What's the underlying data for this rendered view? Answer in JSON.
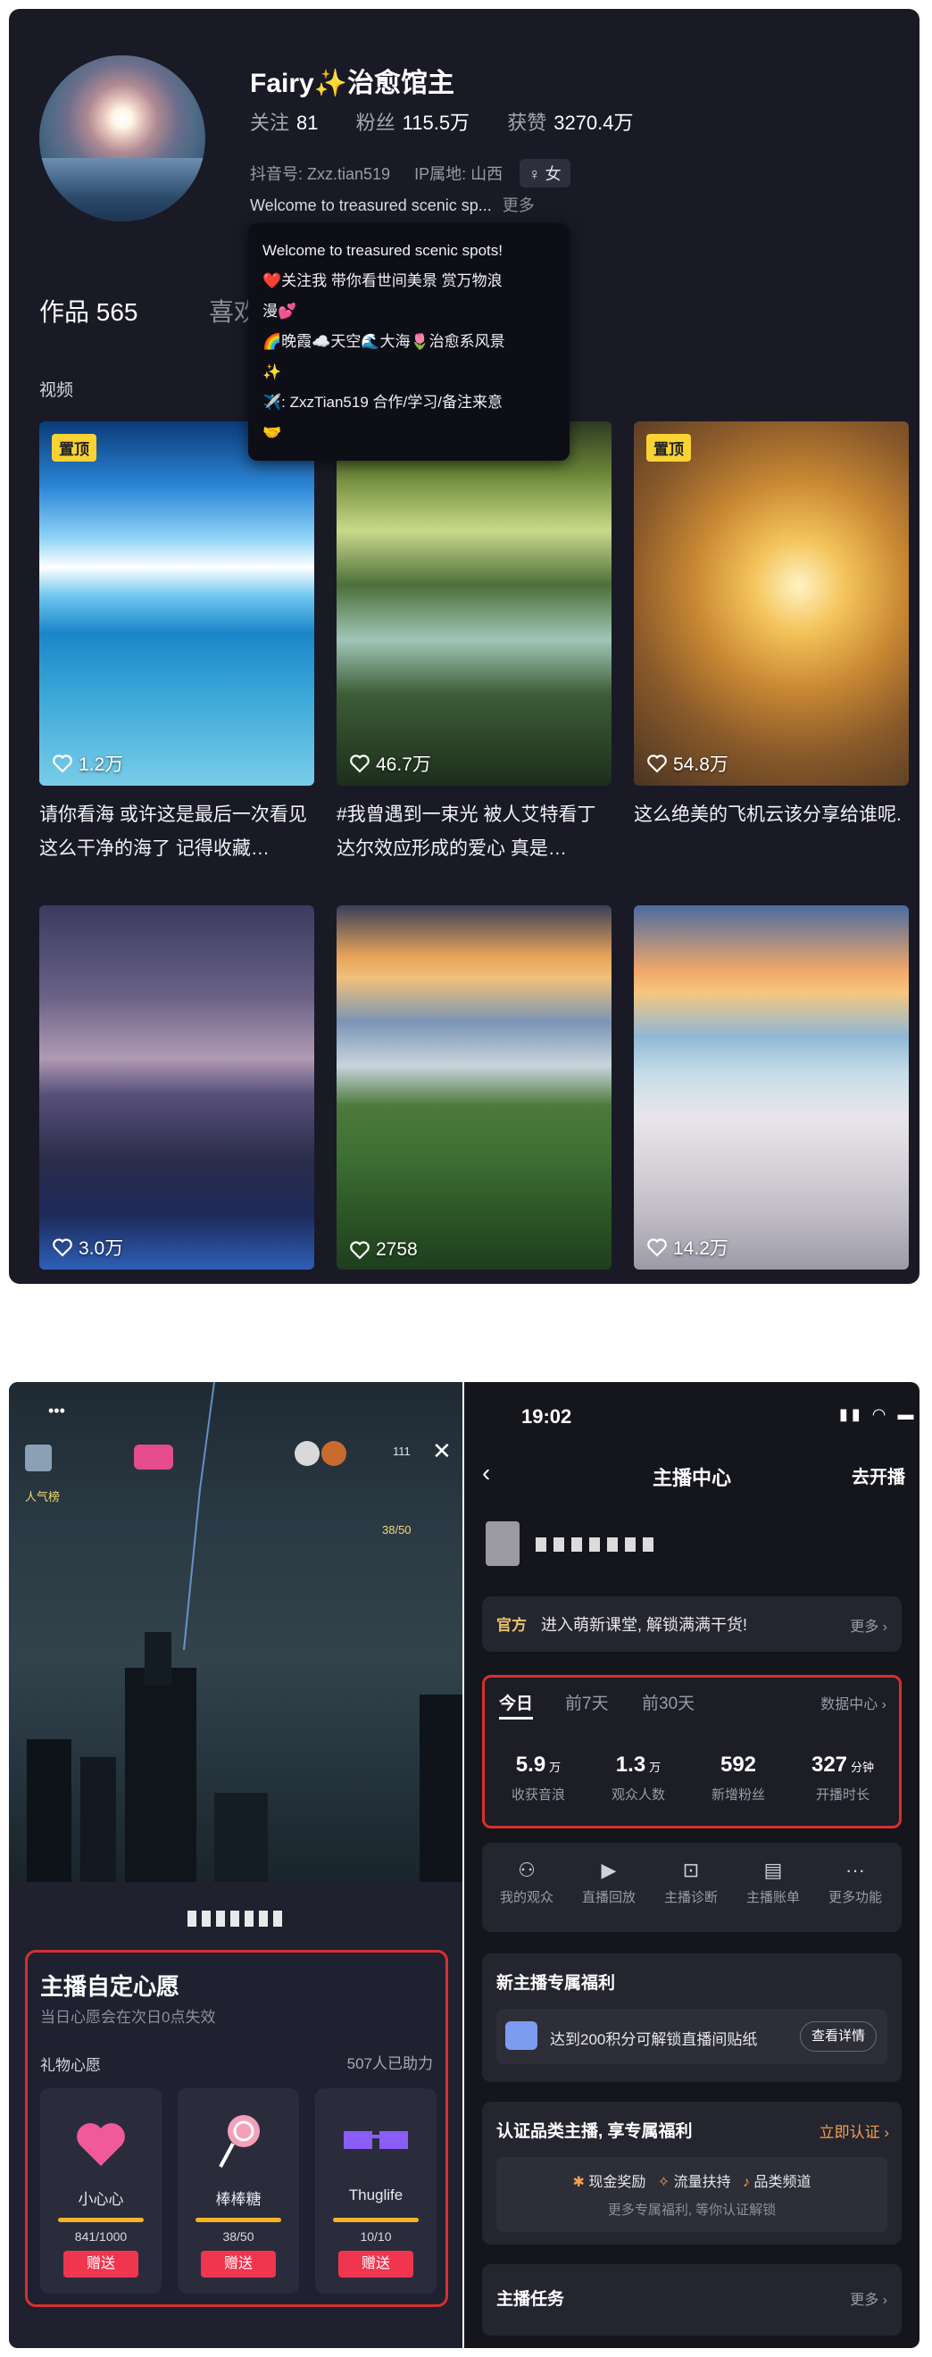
{
  "profile": {
    "name": "Fairy✨治愈馆主",
    "following_label": "关注",
    "following": "81",
    "fans_label": "粉丝",
    "fans": "115.5万",
    "likes_label": "获赞",
    "likes": "3270.4万",
    "douyin_id": "抖音号: Zxz.tian519",
    "ip_location": "IP属地: 山西",
    "gender": "♀ 女",
    "bio_preview": "Welcome to treasured scenic sp...",
    "more": "更多"
  },
  "bio_popup": {
    "lines": [
      "Welcome to treasured scenic spots!",
      "❤️关注我 带你看世间美景 赏万物浪",
      "漫💕",
      "🌈晚霞☁️天空🌊大海🌷治愈系风景",
      "✨",
      "✈️: ZxzTian519 合作/学习/备注来意",
      "🤝"
    ]
  },
  "tabs": {
    "works": "作品 565",
    "likes": "喜欢"
  },
  "section_label": "视频",
  "videos": [
    {
      "pinned": "置顶",
      "likes": "1.2万",
      "caption": "请你看海 或许这是最后一次看见这么干净的海了 记得收藏…"
    },
    {
      "pinned": "",
      "likes": "46.7万",
      "caption": "#我曾遇到一束光 被人艾特看丁达尔效应形成的爱心 真是…"
    },
    {
      "pinned": "置顶",
      "likes": "54.8万",
      "caption": "这么绝美的飞机云该分享给谁呢."
    },
    {
      "pinned": "",
      "likes": "3.0万",
      "caption": ""
    },
    {
      "pinned": "",
      "likes": "2758",
      "caption": ""
    },
    {
      "pinned": "",
      "likes": "14.2万",
      "caption": ""
    }
  ],
  "live": {
    "viewer_count": "111",
    "popularity": "人气榜",
    "wish_progress": "38/50",
    "wish_title": "主播自定心愿",
    "wish_sub": "当日心愿会在次日0点失效",
    "gift_label": "礼物心愿",
    "helpers": "507人已助力",
    "gifts": [
      {
        "name": "小心心",
        "progress": "841/1000",
        "button": "赠送"
      },
      {
        "name": "棒棒糖",
        "progress": "38/50",
        "button": "赠送"
      },
      {
        "name": "Thuglife",
        "progress": "10/10",
        "button": "赠送"
      }
    ]
  },
  "anchor": {
    "time": "19:02",
    "title": "主播中心",
    "go_live": "去开播",
    "notice_tag": "官方",
    "notice_text": "进入萌新课堂, 解锁满满干货!",
    "notice_more": "更多",
    "period_tabs": [
      "今日",
      "前7天",
      "前30天"
    ],
    "data_center": "数据中心",
    "stats": [
      {
        "value": "5.9",
        "unit": "万",
        "label": "收获音浪"
      },
      {
        "value": "1.3",
        "unit": "万",
        "label": "观众人数"
      },
      {
        "value": "592",
        "unit": "",
        "label": "新增粉丝"
      },
      {
        "value": "327",
        "unit": "分钟",
        "label": "开播时长"
      }
    ],
    "tools": [
      "我的观众",
      "直播回放",
      "主播诊断",
      "主播账单",
      "更多功能"
    ],
    "newbie_title": "新主播专属福利",
    "newbie_text": "达到200积分可解锁直播间贴纸",
    "newbie_btn": "查看详情",
    "cert_title": "认证品类主播, 享专属福利",
    "cert_link": "立即认证",
    "cert_items": [
      "现金奖励",
      "流量扶持",
      "品类频道"
    ],
    "cert_more": "更多专属福利, 等你认证解锁",
    "tasks_title": "主播任务",
    "tasks_more": "更多"
  }
}
